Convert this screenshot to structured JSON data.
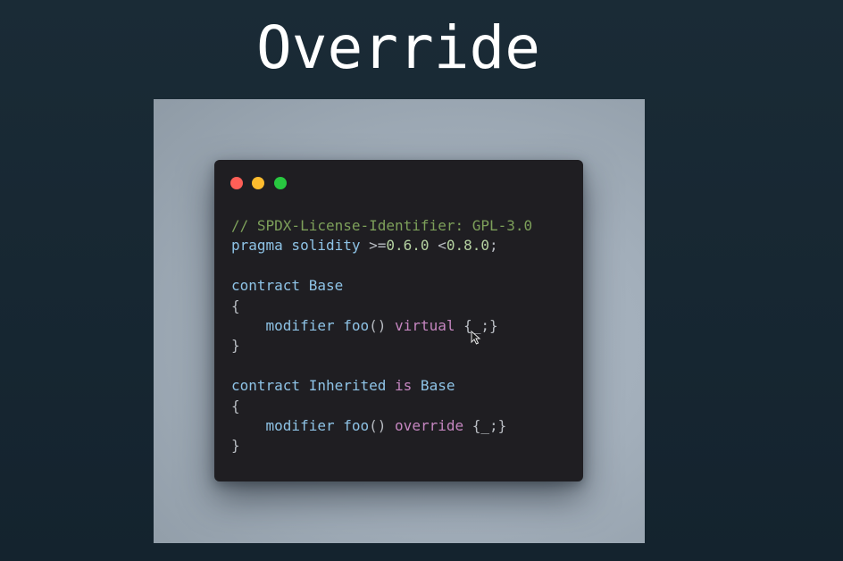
{
  "slide": {
    "title": "Override"
  },
  "code_window": {
    "controls": [
      "close",
      "minimize",
      "maximize"
    ],
    "lines": [
      {
        "parts": [
          {
            "text": "// SPDX-License-Identifier: GPL-3.0",
            "kind": "comment"
          }
        ]
      },
      {
        "parts": [
          {
            "text": "pragma solidity ",
            "kind": "keyword"
          },
          {
            "text": ">=",
            "kind": "punct"
          },
          {
            "text": "0.6.0",
            "kind": "number"
          },
          {
            "text": " <",
            "kind": "punct"
          },
          {
            "text": "0.8.0",
            "kind": "number"
          },
          {
            "text": ";",
            "kind": "punct"
          }
        ]
      },
      {
        "parts": []
      },
      {
        "parts": [
          {
            "text": "contract Base",
            "kind": "keyword"
          }
        ]
      },
      {
        "parts": [
          {
            "text": "{",
            "kind": "punct"
          }
        ]
      },
      {
        "parts": [
          {
            "text": "    modifier ",
            "kind": "keyword"
          },
          {
            "text": "foo",
            "kind": "ident"
          },
          {
            "text": "() ",
            "kind": "punct"
          },
          {
            "text": "virtual",
            "kind": "modifier"
          },
          {
            "text": " {_;}",
            "kind": "punct"
          }
        ]
      },
      {
        "parts": [
          {
            "text": "}",
            "kind": "punct"
          }
        ]
      },
      {
        "parts": []
      },
      {
        "parts": [
          {
            "text": "contract Inherited ",
            "kind": "keyword"
          },
          {
            "text": "is",
            "kind": "modifier"
          },
          {
            "text": " Base",
            "kind": "keyword"
          }
        ]
      },
      {
        "parts": [
          {
            "text": "{",
            "kind": "punct"
          }
        ]
      },
      {
        "parts": [
          {
            "text": "    modifier ",
            "kind": "keyword"
          },
          {
            "text": "foo",
            "kind": "ident"
          },
          {
            "text": "() ",
            "kind": "punct"
          },
          {
            "text": "override",
            "kind": "modifier"
          },
          {
            "text": " {_;}",
            "kind": "punct"
          }
        ]
      },
      {
        "parts": [
          {
            "text": "}",
            "kind": "punct"
          }
        ]
      }
    ]
  },
  "icons": {
    "cursor": "mouse-pointer-icon"
  },
  "colors": {
    "background": "#16252f",
    "panel": "#a3afbb",
    "code_bg": "#1f1e22",
    "close": "#ff5f57",
    "minimize": "#febc2e",
    "maximize": "#28c840",
    "comment": "#7da05a",
    "keyword": "#8ec3e6",
    "number": "#b4d1a0",
    "modifier": "#c586c0",
    "punct": "#b8bcc2"
  }
}
